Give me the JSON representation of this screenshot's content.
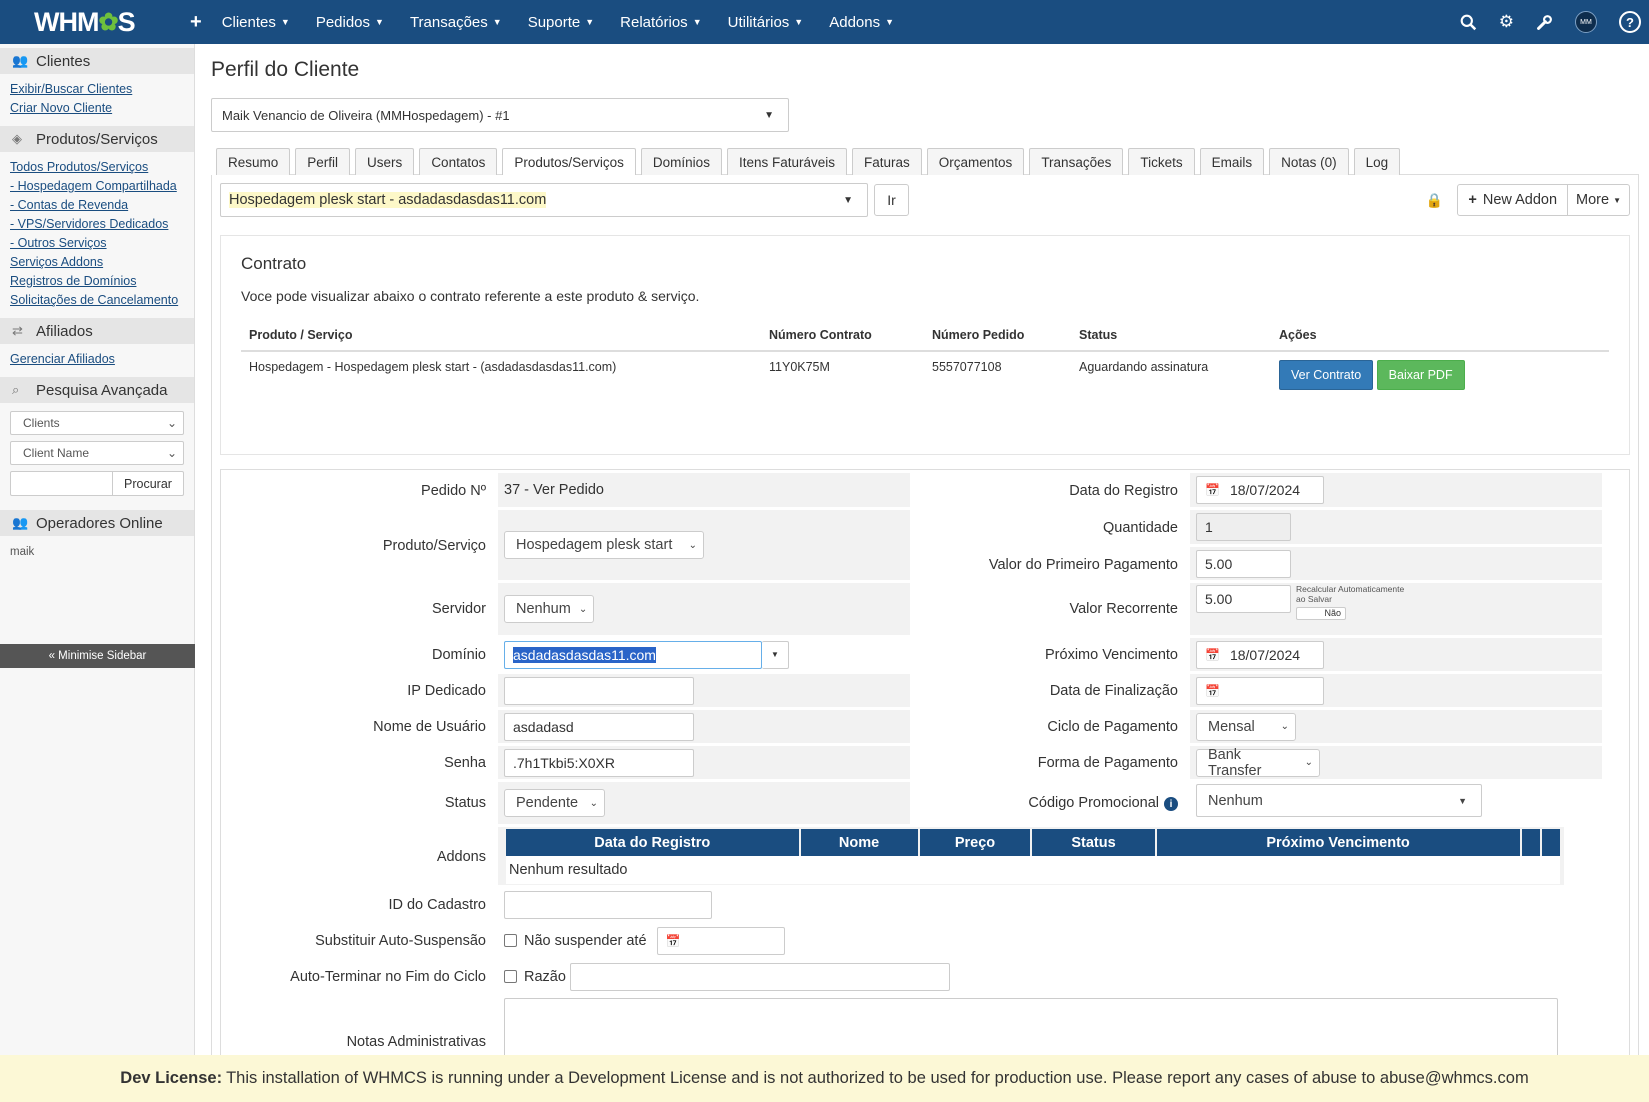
{
  "topbar": {
    "logo_left": "WHM",
    "logo_right": "S",
    "nav": [
      {
        "label": "Clientes"
      },
      {
        "label": "Pedidos"
      },
      {
        "label": "Transações"
      },
      {
        "label": "Suporte"
      },
      {
        "label": "Relatórios"
      },
      {
        "label": "Utilitários"
      },
      {
        "label": "Addons"
      }
    ],
    "avatar_text": "MM"
  },
  "sidebar": {
    "clients_title": "Clientes",
    "clients_links": [
      "Exibir/Buscar Clientes",
      "Criar Novo Cliente"
    ],
    "products_title": "Produtos/Serviços",
    "products_links": [
      "Todos Produtos/Serviços",
      "- Hospedagem Compartilhada",
      "- Contas de Revenda",
      "- VPS/Servidores Dedicados",
      "- Outros Serviços",
      "Serviços Addons",
      "Registros de Domínios",
      "Solicitações de Cancelamento"
    ],
    "affiliates_title": "Afiliados",
    "affiliates_links": [
      "Gerenciar Afiliados"
    ],
    "search_title": "Pesquisa Avançada",
    "search_type": "Clients",
    "search_field": "Client Name",
    "search_button": "Procurar",
    "online_title": "Operadores Online",
    "online_user": "maik",
    "minimise": "« Minimise Sidebar"
  },
  "main": {
    "title": "Perfil do Cliente",
    "client_select": "Maik Venancio de Oliveira (MMHospedagem) - #1",
    "tabs": [
      "Resumo",
      "Perfil",
      "Users",
      "Contatos",
      "Produtos/Serviços",
      "Domínios",
      "Itens Faturáveis",
      "Faturas",
      "Orçamentos",
      "Transações",
      "Tickets",
      "Emails",
      "Notas (0)",
      "Log"
    ],
    "active_tab": "Produtos/Serviços",
    "service_select": "Hospedagem plesk start - asdadasdasdas11.com",
    "go_button": "Ir",
    "new_addon": "New Addon",
    "more": "More"
  },
  "contract": {
    "title": "Contrato",
    "description": "Voce pode visualizar abaixo o contrato referente a este produto & serviço.",
    "headers": [
      "Produto / Serviço",
      "Número Contrato",
      "Número Pedido",
      "Status",
      "Ações"
    ],
    "row": {
      "product": "Hospedagem - Hospedagem plesk start - (asdadasdasdas11.com)",
      "contract_no": "11Y0K75M",
      "order_no": "5557077108",
      "status": "Aguardando assinatura"
    },
    "view_button": "Ver Contrato",
    "pdf_button": "Baixar PDF"
  },
  "form": {
    "order_label": "Pedido Nº",
    "order_value": "37 - Ver Pedido",
    "product_label": "Produto/Serviço",
    "product_value": "Hospedagem plesk start",
    "server_label": "Servidor",
    "server_value": "Nenhum",
    "domain_label": "Domínio",
    "domain_value": "asdadasdasdas11.com",
    "ip_label": "IP Dedicado",
    "username_label": "Nome de Usuário",
    "username_value": "asdadasd",
    "password_label": "Senha",
    "password_value": ".7h1Tkbi5:X0XR",
    "status_label": "Status",
    "status_value": "Pendente",
    "reg_date_label": "Data do Registro",
    "reg_date_value": "18/07/2024",
    "qty_label": "Quantidade",
    "qty_value": "1",
    "first_payment_label": "Valor do Primeiro Pagamento",
    "first_payment_value": "5.00",
    "recurring_label": "Valor Recorrente",
    "recurring_value": "5.00",
    "recalc_text": "Recalcular Automaticamente ao Salvar",
    "recalc_toggle": "Não",
    "next_due_label": "Próximo Vencimento",
    "next_due_value": "18/07/2024",
    "termination_label": "Data de Finalização",
    "cycle_label": "Ciclo de Pagamento",
    "cycle_value": "Mensal",
    "payment_method_label": "Forma de Pagamento",
    "payment_method_value": "Bank Transfer",
    "promo_label": "Código Promocional",
    "promo_value": "Nenhum",
    "addons_label": "Addons",
    "addons_headers": [
      "Data do Registro",
      "Nome",
      "Preço",
      "Status",
      "Próximo Vencimento"
    ],
    "addons_empty": "Nenhum resultado",
    "subscription_label": "ID do Cadastro",
    "override_label": "Substituir Auto-Suspensão",
    "override_text": "Não suspender até",
    "autoterm_label": "Auto-Terminar no Fim do Ciclo",
    "autoterm_text": "Razão",
    "notes_label": "Notas Administrativas"
  },
  "dev_license": {
    "label": "Dev License:",
    "text": "This installation of WHMCS is running under a Development License and is not authorized to be used for production use. Please report any cases of abuse to abuse@whmcs.com"
  },
  "colors": {
    "primary": "#1a4d80",
    "accent_green": "#6ec03c",
    "highlight": "#fdf8c8"
  }
}
